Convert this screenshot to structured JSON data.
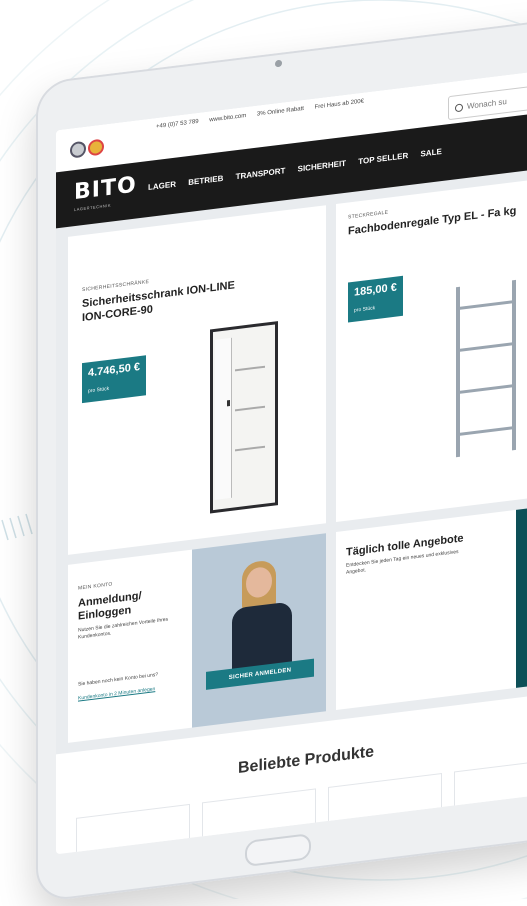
{
  "topbar": {
    "utility_items": [
      "+49 (0)7 53 789",
      "www.bito.com",
      "3% Online Rabatt",
      "Frei Haus ab 200€"
    ],
    "search_placeholder": "Wonach su"
  },
  "navbar": {
    "logo": "BITO",
    "logo_sub": "LAGERTECHNIK",
    "links": [
      "LAGER",
      "BETRIEB",
      "TRANSPORT",
      "SICHERHEIT",
      "TOP SELLER",
      "SALE"
    ]
  },
  "product1": {
    "category": "SICHERHEITSSCHRÄNKE",
    "title": "Sicherheitsschrank ION-LINE ION-CORE-90",
    "price": "4.746,50 €",
    "unit": "pro Stück"
  },
  "product2": {
    "category": "STECKREGALE",
    "title": "Fachbodenregale Typ EL - Fa kg",
    "price": "185,00 €",
    "unit": "pro Stück"
  },
  "account": {
    "kicker": "MEIN KONTO",
    "title": "Anmeldung/ Einloggen",
    "text": "Nutzen Sie die zahlreichen Vorteile Ihres Kundenkontos.",
    "question": "Sie haben noch kein Konto bei uns?",
    "link": "Kundenkonto in 2 Minuten anlegen",
    "button": "SICHER ANMELDEN"
  },
  "offers": {
    "title": "Täglich tolle Angebote",
    "text": "Entdecken Sie jeden Tag ein neues und exklusives Angebot."
  },
  "popular": {
    "title": "Beliebte Produkte"
  },
  "colors": {
    "accent": "#1b7a84",
    "nav_bg": "#1a1a1a"
  }
}
